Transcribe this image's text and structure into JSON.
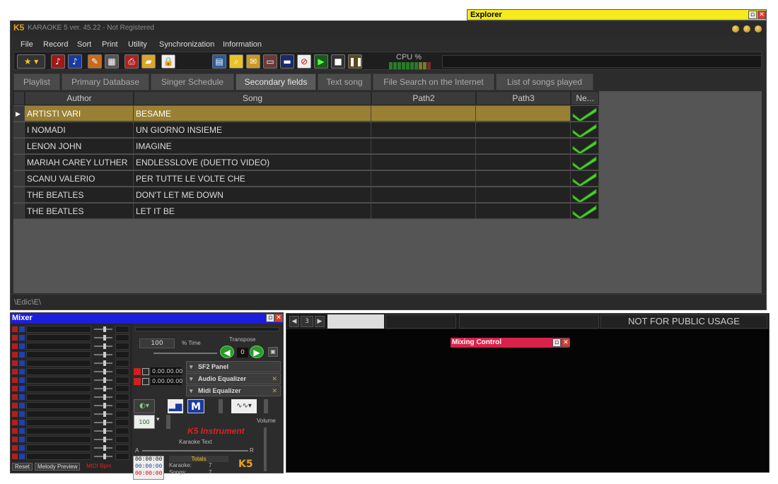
{
  "explorer": {
    "title": "Explorer"
  },
  "window": {
    "logo": "K5",
    "title": "KARAOKE 5   ver. 45.22 - Not Registered"
  },
  "menu": [
    "File",
    "Record",
    "Sort",
    "Print",
    "Utility",
    "Synchronization",
    "Information"
  ],
  "toolbar": {
    "cpu_label": "CPU %"
  },
  "tabs": [
    {
      "label": "Playlist"
    },
    {
      "label": "Primary Database"
    },
    {
      "label": "Singer Schedule"
    },
    {
      "label": "Secondary fields"
    },
    {
      "label": "Text song"
    },
    {
      "label": "File Search on the Internet"
    },
    {
      "label": "List of songs played"
    }
  ],
  "grid": {
    "headers": [
      "Author",
      "Song",
      "Path2",
      "Path3",
      "Ne..."
    ],
    "rows": [
      {
        "author": "ARTISTI VARI",
        "song": "BESAME",
        "path2": "",
        "path3": ""
      },
      {
        "author": "I NOMADI",
        "song": "UN GIORNO INSIEME",
        "path2": "",
        "path3": ""
      },
      {
        "author": "LENON JOHN",
        "song": "IMAGINE",
        "path2": "",
        "path3": ""
      },
      {
        "author": "MARIAH CAREY  LUTHER",
        "song": "ENDLESSLOVE (DUETTO  VIDEO)",
        "path2": "",
        "path3": ""
      },
      {
        "author": "SCANU VALERIO",
        "song": "PER TUTTE LE VOLTE CHE",
        "path2": "",
        "path3": ""
      },
      {
        "author": "THE BEATLES",
        "song": "DON'T LET ME DOWN",
        "path2": "",
        "path3": ""
      },
      {
        "author": "THE BEATLES",
        "song": "LET IT BE",
        "path2": "",
        "path3": ""
      }
    ]
  },
  "statusbar": {
    "path": "\\Edic\\E\\"
  },
  "mixer": {
    "title": "Mixer",
    "tempo_value": "100",
    "tempo_label": "% Time",
    "transpose_label": "Transpose",
    "transpose_value": "0",
    "time_a": "0.00.00.00",
    "time_b": "0.00.00.00",
    "sf2_panel": "SF2 Panel",
    "audio_eq": "Audio Equalizer",
    "midi_eq": "Midi Equalizer",
    "k5_instrument": "K5 Instrument",
    "karaoke_text": "Karaoke Text",
    "volume": "Volume",
    "a_label": "A",
    "r_label": "R",
    "speed_value": "100",
    "times": [
      "00:00:00",
      "00:00:00",
      "00:00:00"
    ],
    "totals_label": "Totals",
    "karaoke_label": "Karaoke:",
    "karaoke_count": "7",
    "songs_label": "Songs:",
    "songs_count": "7",
    "reset": "Reset",
    "melody_preview": "Melody Preview",
    "midi_bpm": "MIDI Bpm"
  },
  "video": {
    "page": "3",
    "not_public": "NOT FOR PUBLIC USAGE",
    "mixing_control": "Mixing Control"
  }
}
